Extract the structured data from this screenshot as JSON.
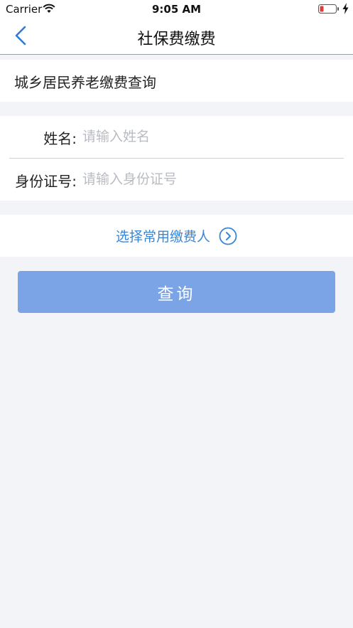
{
  "status_bar": {
    "carrier": "Carrier",
    "time": "9:05 AM",
    "battery_color": "#e53935"
  },
  "nav": {
    "title": "社保费缴费",
    "back_icon": "chevron-left-icon",
    "accent": "#2f7bd4"
  },
  "section": {
    "title": "城乡居民养老缴费查询"
  },
  "form": {
    "name_label": "姓名:",
    "name_value": "",
    "name_placeholder": "请输入姓名",
    "id_label": "身份证号:",
    "id_value": "",
    "id_placeholder": "请输入身份证号"
  },
  "common_payer": {
    "label": "选择常用缴费人",
    "icon": "chevron-right-circle-icon",
    "color": "#3a86d6"
  },
  "query_button": {
    "label": "查询",
    "color": "#7ba4e6"
  }
}
